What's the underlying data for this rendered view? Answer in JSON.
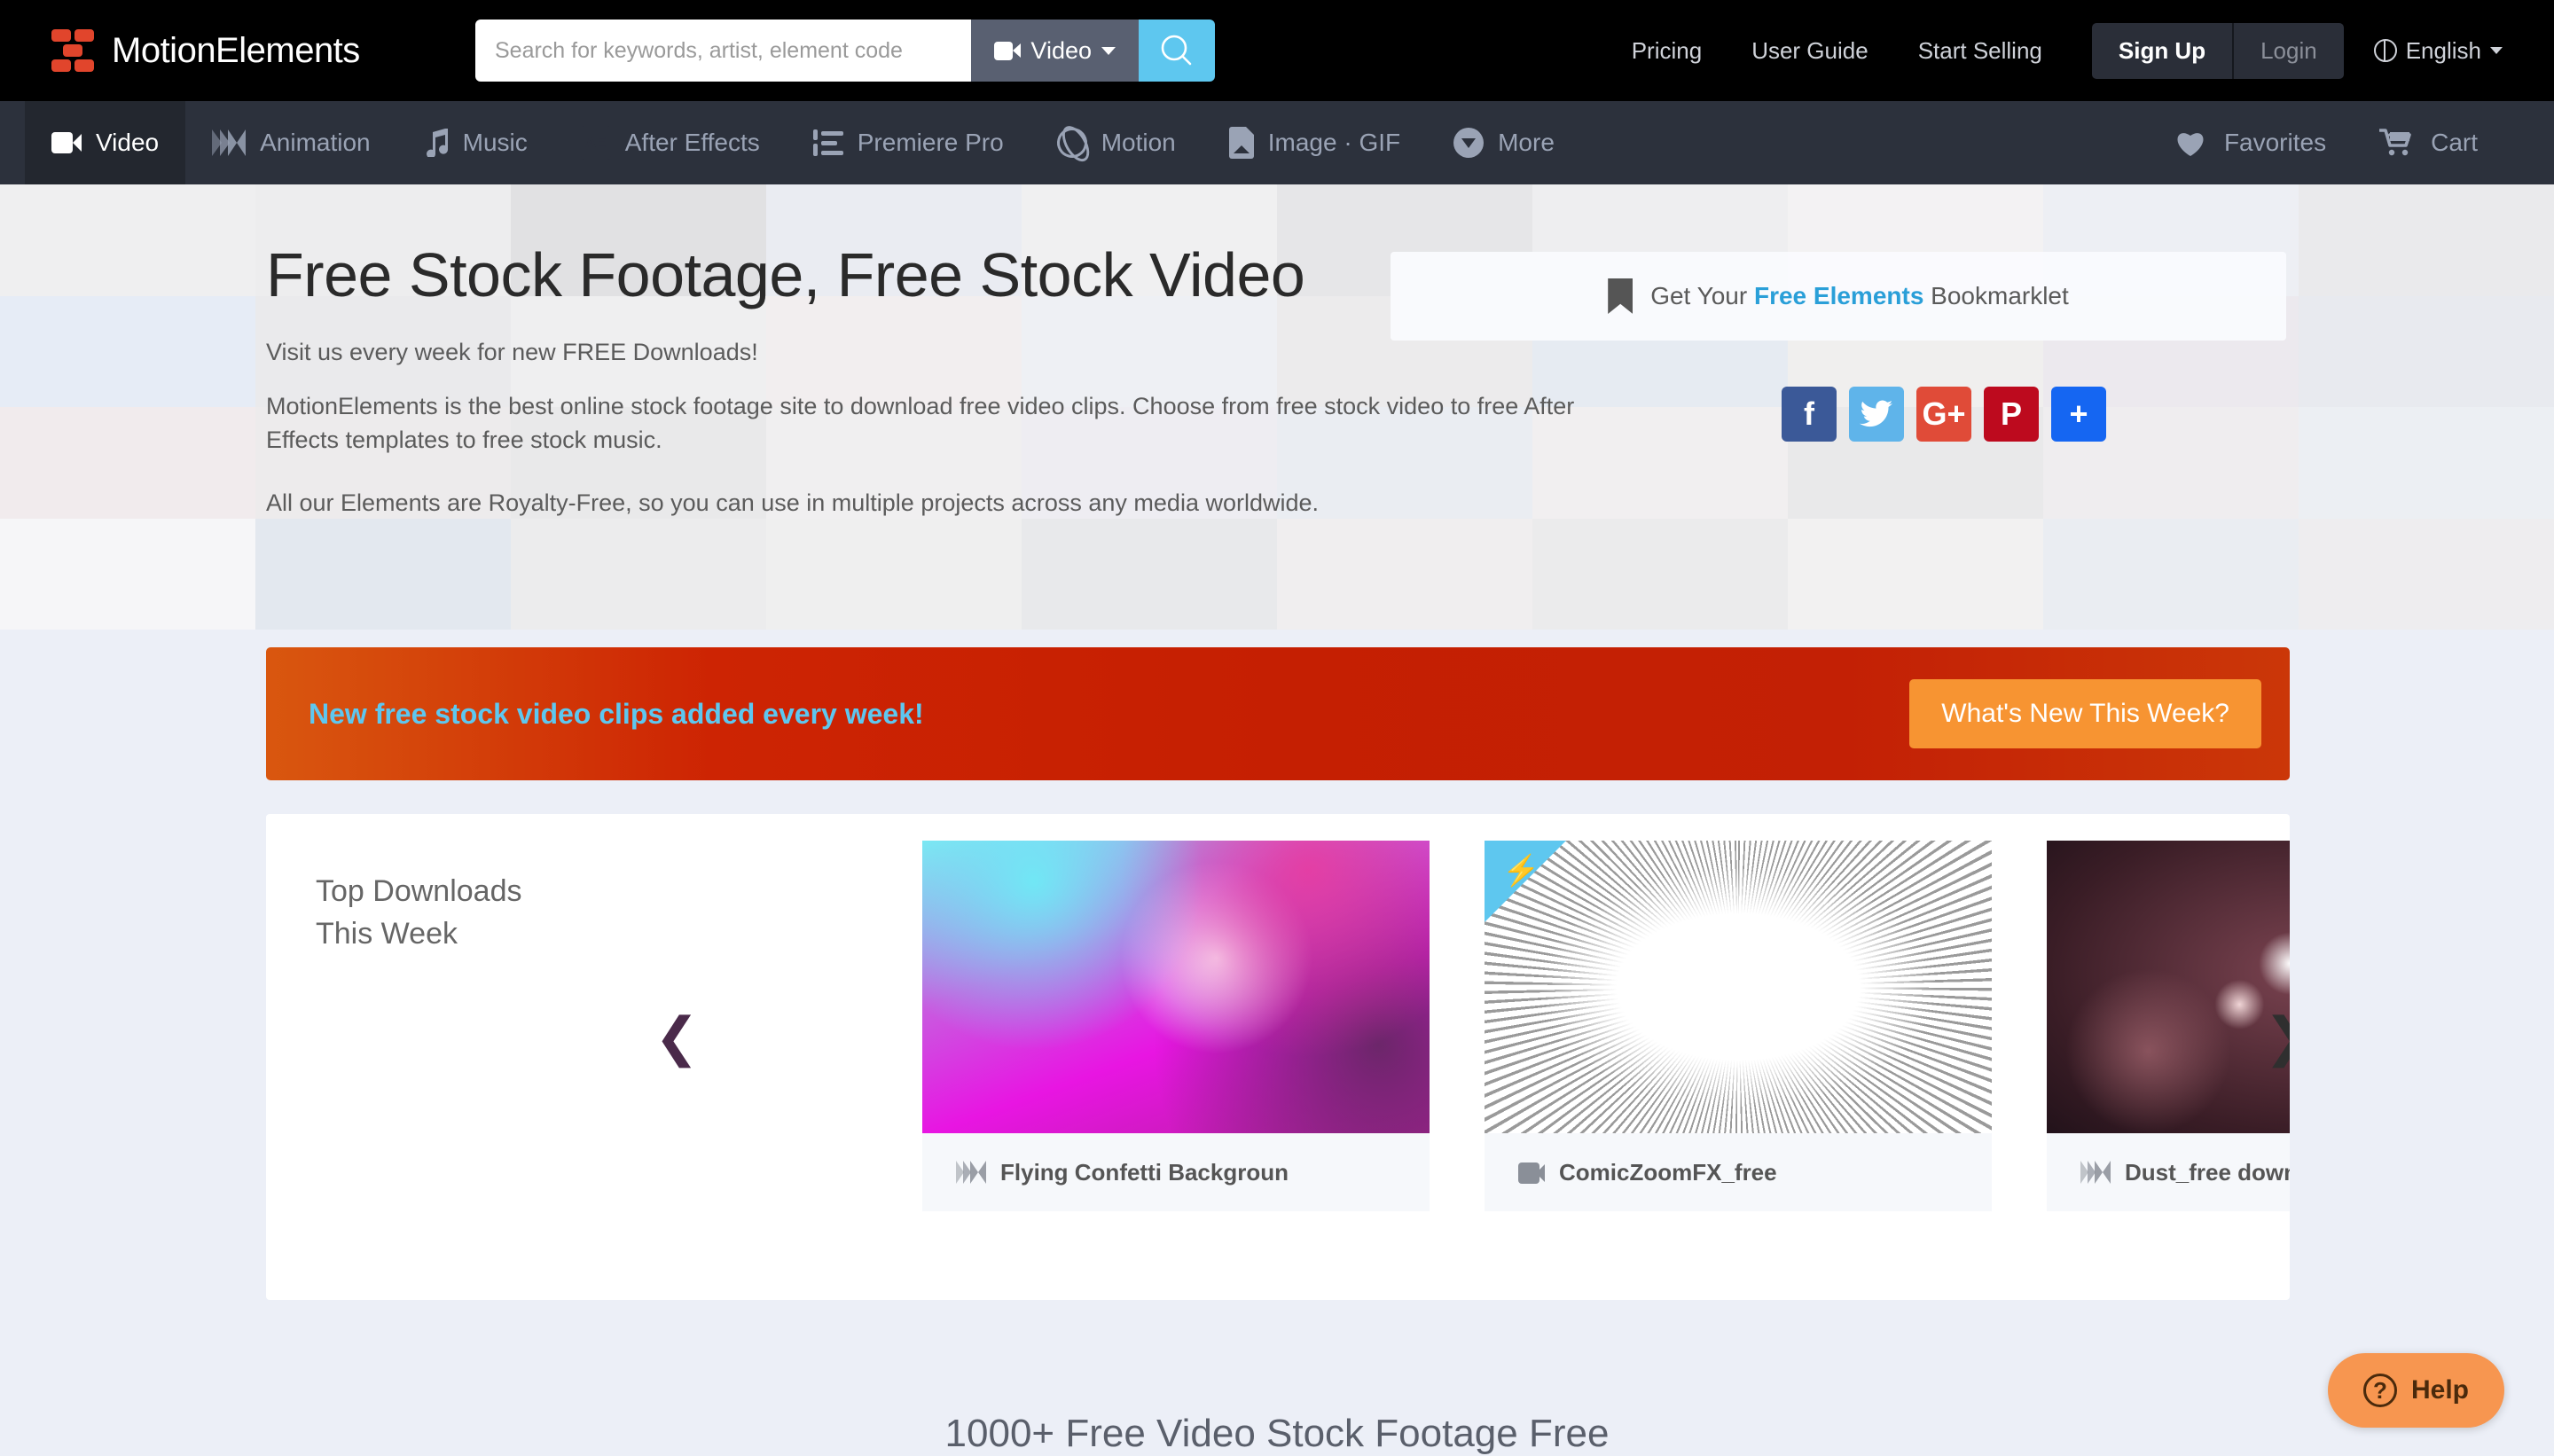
{
  "brand": {
    "name": "MotionElements",
    "logo_icon": "motionelements-logo-icon"
  },
  "search": {
    "placeholder": "Search for keywords, artist, element code",
    "value": "",
    "type_label": "Video",
    "type_icon": "video-camera-icon",
    "submit_icon": "search-icon"
  },
  "top_links": [
    {
      "label": "Pricing"
    },
    {
      "label": "User Guide"
    },
    {
      "label": "Start Selling"
    }
  ],
  "auth": {
    "signup": "Sign Up",
    "login": "Login"
  },
  "language": {
    "label": "English",
    "icon": "globe-icon"
  },
  "nav": {
    "items": [
      {
        "label": "Video",
        "icon": "video-camera-icon",
        "active": true
      },
      {
        "label": "Animation",
        "icon": "animation-icon",
        "active": false
      },
      {
        "label": "Music",
        "icon": "music-note-icon",
        "active": false
      },
      {
        "label": "After Effects",
        "icon": "after-effects-icon",
        "active": false
      },
      {
        "label": "Premiere Pro",
        "icon": "premiere-pro-icon",
        "active": false
      },
      {
        "label": "Motion",
        "icon": "motion-icon",
        "active": false
      },
      {
        "label": "Image · GIF",
        "icon": "image-file-icon",
        "active": false
      },
      {
        "label": "More",
        "icon": "chevron-down-circle-icon",
        "active": false
      }
    ],
    "right": [
      {
        "label": "Favorites",
        "icon": "heart-icon"
      },
      {
        "label": "Cart",
        "icon": "cart-icon"
      }
    ]
  },
  "hero": {
    "title": "Free Stock Footage, Free Stock Video",
    "subtitle": "Visit us every week for new FREE Downloads!",
    "paragraph1": "MotionElements is the best online stock footage site to download free video clips. Choose from free stock video to free After Effects templates to free stock music.",
    "paragraph2": "All our Elements are Royalty-Free, so you can use in multiple projects across any media worldwide.",
    "bookmarklet": {
      "icon": "bookmark-icon",
      "prefix": "Get Your ",
      "highlight": "Free Elements",
      "suffix": " Bookmarklet"
    },
    "socials": [
      {
        "name": "facebook-share-button",
        "glyph": "f",
        "color": "#3b5998"
      },
      {
        "name": "twitter-share-button",
        "glyph": "t",
        "color": "#5fb4ea"
      },
      {
        "name": "googleplus-share-button",
        "glyph": "G+",
        "color": "#e04b38"
      },
      {
        "name": "pinterest-share-button",
        "glyph": "P",
        "color": "#bd0a1e"
      },
      {
        "name": "more-share-button",
        "glyph": "+",
        "color": "#1566f2"
      }
    ]
  },
  "promo": {
    "highlight": "New",
    "text": " free stock video clips added every week!",
    "button": "What's New This Week?",
    "button_color": "#f79432"
  },
  "carousel": {
    "title": "Top Downloads\nThis Week",
    "prev_icon": "chevron-left-icon",
    "next_icon": "chevron-right-icon",
    "cards": [
      {
        "title": "Flying Confetti Backgroun",
        "type_icon": "animation-icon",
        "badge": ""
      },
      {
        "title": "ComicZoomFX_free",
        "type_icon": "video-camera-icon",
        "badge": "free-lightning-badge"
      },
      {
        "title": "Dust_free download (with",
        "type_icon": "animation-icon",
        "badge": ""
      }
    ]
  },
  "bottom": {
    "heading": "1000+ Free Video Stock Footage Free"
  },
  "help": {
    "label": "Help",
    "icon": "question-circle-icon"
  },
  "colors": {
    "accent_blue": "#5ec7ef",
    "brand_red": "#e1452c",
    "promo_orange": "#f79432",
    "nav_bg": "#2c313c",
    "page_bg": "#eceff7"
  }
}
